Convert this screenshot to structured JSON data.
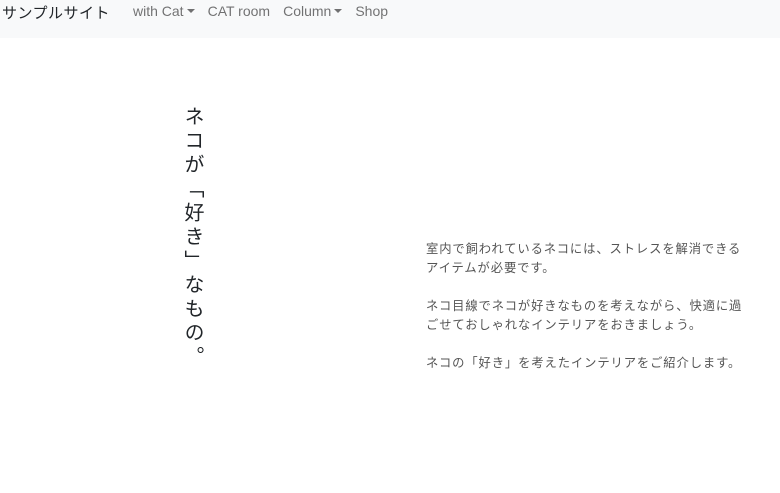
{
  "nav": {
    "brand": "サンプルサイト",
    "items": [
      {
        "label": "with Cat",
        "dropdown": true
      },
      {
        "label": "CAT room",
        "dropdown": false
      },
      {
        "label": "Column",
        "dropdown": true
      },
      {
        "label": "Shop",
        "dropdown": false
      }
    ]
  },
  "hero": {
    "vertical_heading": "ネコが「好き」なもの。",
    "paragraphs": [
      "室内で飼われているネコには、ストレスを解消できるアイテムが必要です。",
      "ネコ目線でネコが好きなものを考えながら、快適に過ごせておしゃれなインテリアをおきましょう。",
      "ネコの「好き」を考えたインテリアをご紹介します。"
    ]
  },
  "colors": {
    "navbar_bg": "#f8f9fa",
    "nav_link": "#8a8a8a",
    "text": "#555555"
  }
}
